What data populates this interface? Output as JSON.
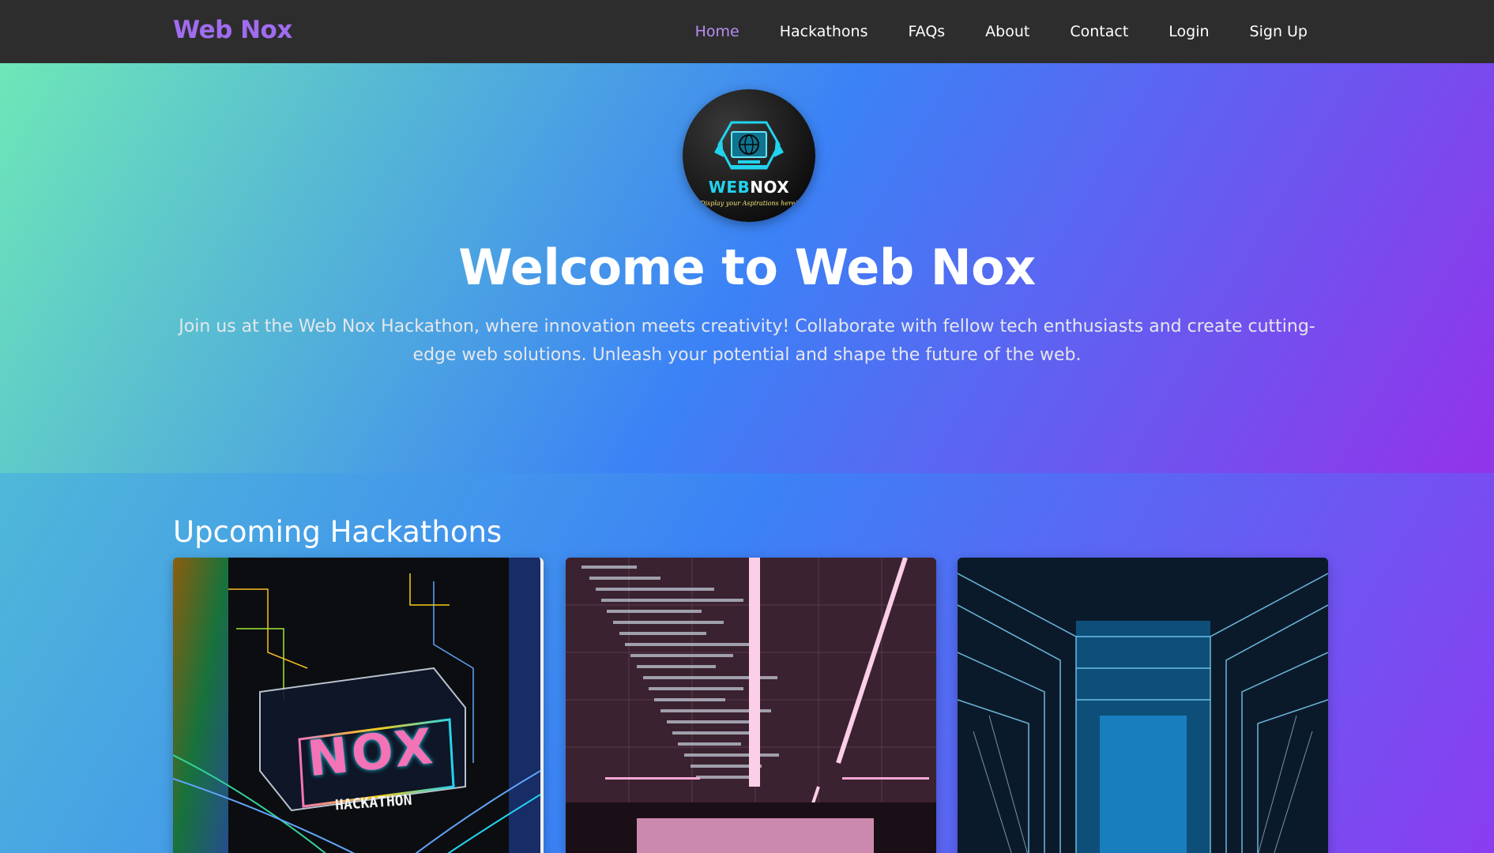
{
  "navbar": {
    "brand": "Web Nox",
    "brand_color": "#a06cf0",
    "active_color": "#b98cf5",
    "links": [
      {
        "label": "Home",
        "active": true
      },
      {
        "label": "Hackathons",
        "active": false
      },
      {
        "label": "FAQs",
        "active": false
      },
      {
        "label": "About",
        "active": false
      },
      {
        "label": "Contact",
        "active": false
      },
      {
        "label": "Login",
        "active": false
      },
      {
        "label": "Sign Up",
        "active": false
      }
    ]
  },
  "hero": {
    "logo": {
      "word_web": "WEB",
      "word_nox": "NOX",
      "tagline": "Display your Aspirations here!"
    },
    "title": "Welcome to Web Nox",
    "description": "Join us at the Web Nox Hackathon, where innovation meets creativity! Collaborate with fellow tech enthusiasts and create cutting-edge web solutions. Unleash your potential and shape the future of the web."
  },
  "upcoming": {
    "title": "Upcoming Hackathons",
    "cards": [
      {
        "image": "neon-nox-hackathon-image",
        "image_text": "NOX",
        "caption": "HACKATHON"
      },
      {
        "image": "neon-code-corridor-image"
      },
      {
        "image": "blue-server-hall-image"
      }
    ]
  },
  "colors": {
    "navbar_bg": "#2d2d2d",
    "gradient_start": "#6ee7b7",
    "gradient_mid": "#3b82f6",
    "gradient_end": "#9333ea"
  }
}
